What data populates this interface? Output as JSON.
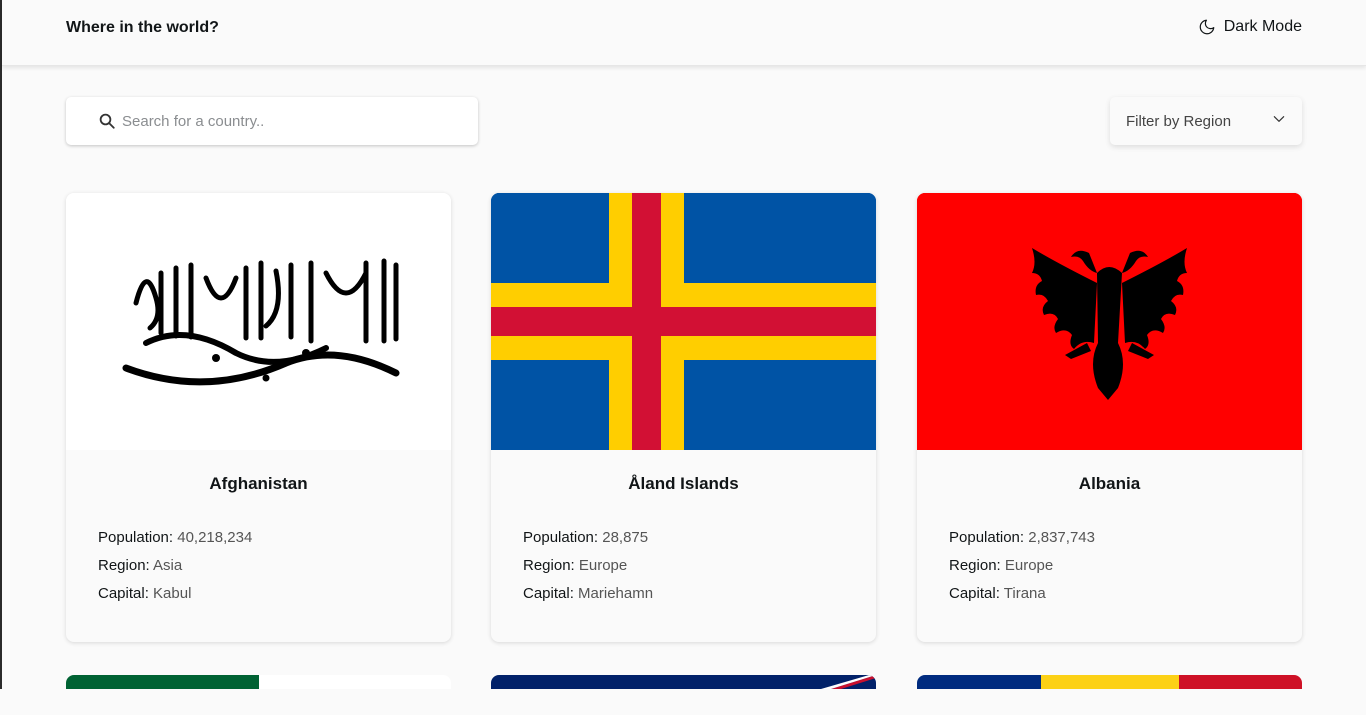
{
  "header": {
    "title": "Where in the world?",
    "theme_toggle_label": "Dark Mode",
    "theme_toggle_icon": "moon-icon"
  },
  "search": {
    "placeholder": "Search for a country..",
    "value": "",
    "icon": "search-icon"
  },
  "filter": {
    "label": "Filter by Region",
    "icon": "chevron-down-icon"
  },
  "labels": {
    "population": "Population:",
    "region": "Region:",
    "capital": "Capital:"
  },
  "countries": [
    {
      "name": "Afghanistan",
      "population": "40,218,234",
      "region": "Asia",
      "capital": "Kabul",
      "flag": "afghanistan-flag"
    },
    {
      "name": "Åland Islands",
      "population": "28,875",
      "region": "Europe",
      "capital": "Mariehamn",
      "flag": "aland-islands-flag"
    },
    {
      "name": "Albania",
      "population": "2,837,743",
      "region": "Europe",
      "capital": "Tirana",
      "flag": "albania-flag"
    }
  ],
  "colors": {
    "background": "#fafafa",
    "text": "#111517",
    "aland_blue": "#0053a5",
    "aland_yellow": "#ffce00",
    "aland_red": "#d21034",
    "albania_red": "#ff0000"
  }
}
